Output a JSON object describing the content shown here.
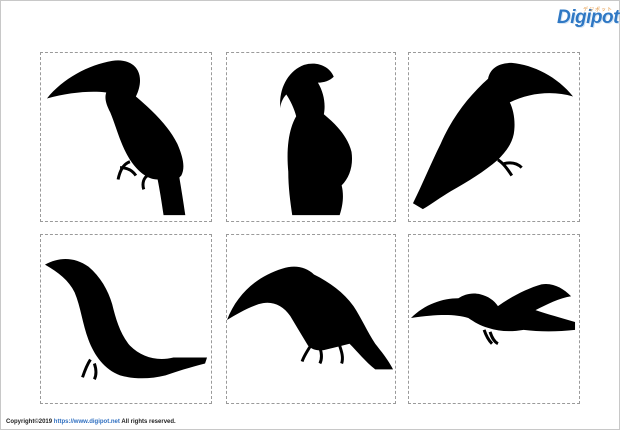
{
  "logo": {
    "text": "Digipot",
    "kana": "デジポット",
    "color": "#2f78c4"
  },
  "silhouettes": [
    {
      "name": "toucan-perched-facing-left",
      "color": "#000000"
    },
    {
      "name": "toucan-perched-head-turned",
      "color": "#000000"
    },
    {
      "name": "toucan-perched-facing-right",
      "color": "#000000"
    },
    {
      "name": "toucan-standing-low",
      "color": "#000000"
    },
    {
      "name": "toucan-crouching",
      "color": "#000000"
    },
    {
      "name": "toucan-flying",
      "color": "#000000"
    }
  ],
  "footer": {
    "copyright": "Copyright©2019",
    "url": "https://www.digipot.net",
    "rights": "All rights reserved."
  }
}
